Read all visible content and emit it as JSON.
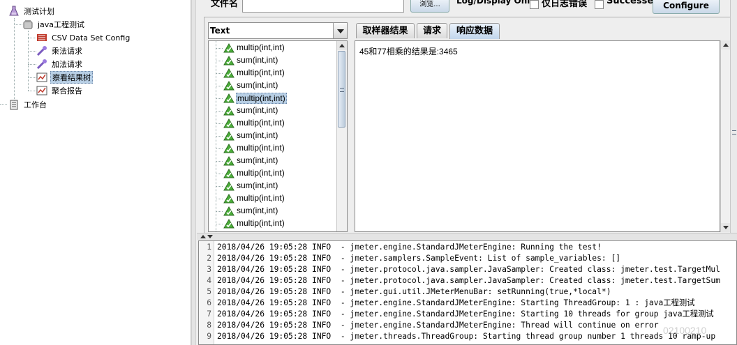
{
  "tree": {
    "items": [
      {
        "label": "测试计划",
        "icon": "test-plan-icon"
      },
      {
        "label": "java工程测试",
        "icon": "thread-group-icon"
      },
      {
        "label": "CSV Data Set Config",
        "icon": "csv-config-icon"
      },
      {
        "label": "乘法请求",
        "icon": "sampler-icon"
      },
      {
        "label": "加法请求",
        "icon": "sampler-icon"
      },
      {
        "label": "察看结果树",
        "icon": "listener-icon"
      },
      {
        "label": "聚合报告",
        "icon": "report-icon"
      },
      {
        "label": "工作台",
        "icon": "workbench-icon"
      }
    ]
  },
  "topbar": {
    "file_label": "文件名",
    "browse_label": "浏览...",
    "log_display_label": "Log/Display Only:",
    "errors_label": "仅日志错误",
    "success_label": "Successes",
    "configure_label": "Configure"
  },
  "renderer": {
    "selected": "Text"
  },
  "samples": [
    "multip(int,int)",
    "sum(int,int)",
    "multip(int,int)",
    "sum(int,int)",
    "multip(int,int)",
    "sum(int,int)",
    "multip(int,int)",
    "sum(int,int)",
    "multip(int,int)",
    "sum(int,int)",
    "multip(int,int)",
    "sum(int,int)",
    "multip(int,int)",
    "sum(int,int)",
    "multip(int,int)"
  ],
  "tabs": [
    {
      "label": "取样器结果"
    },
    {
      "label": "请求"
    },
    {
      "label": "响应数据"
    }
  ],
  "response": {
    "text": "45和77相乘的结果是:3465"
  },
  "log": [
    {
      "num": "1",
      "text": "2018/04/26 19:05:28 INFO  - jmeter.engine.StandardJMeterEngine: Running the test!"
    },
    {
      "num": "2",
      "text": "2018/04/26 19:05:28 INFO  - jmeter.samplers.SampleEvent: List of sample_variables: []"
    },
    {
      "num": "3",
      "text": "2018/04/26 19:05:28 INFO  - jmeter.protocol.java.sampler.JavaSampler: Created class: jmeter.test.TargetMul"
    },
    {
      "num": "4",
      "text": "2018/04/26 19:05:28 INFO  - jmeter.protocol.java.sampler.JavaSampler: Created class: jmeter.test.TargetSum"
    },
    {
      "num": "5",
      "text": "2018/04/26 19:05:28 INFO  - jmeter.gui.util.JMeterMenuBar: setRunning(true,*local*)"
    },
    {
      "num": "6",
      "text": "2018/04/26 19:05:28 INFO  - jmeter.engine.StandardJMeterEngine: Starting ThreadGroup: 1 : java工程测试"
    },
    {
      "num": "7",
      "text": "2018/04/26 19:05:28 INFO  - jmeter.engine.StandardJMeterEngine: Starting 10 threads for group java工程测试"
    },
    {
      "num": "8",
      "text": "2018/04/26 19:05:28 INFO  - jmeter.engine.StandardJMeterEngine: Thread will continue on error"
    },
    {
      "num": "9",
      "text": "2018/04/26 19:05:28 INFO  - jmeter.threads.ThreadGroup: Starting thread group number 1 threads 10 ramp-up"
    }
  ],
  "watermark": "02100210",
  "colors": {
    "selection": "#b8cfe5",
    "active_tab": "#c2d6ec",
    "triangle_green": "#4caf3a"
  }
}
